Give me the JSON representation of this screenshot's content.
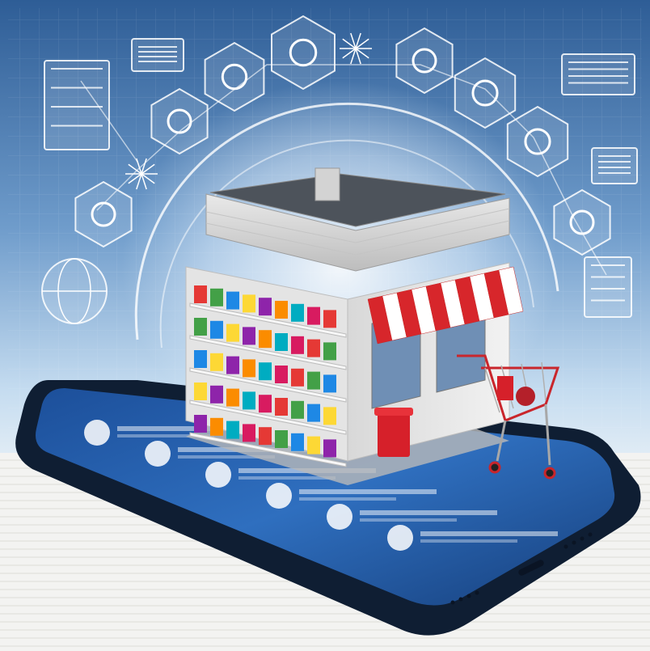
{
  "image": {
    "alt": "",
    "background_color": "#c9dff2",
    "accent_color": "#d7262b",
    "phone_screen_color": "#1e5fae",
    "glow_color": "#e8f4ff"
  },
  "floating_icons": [
    {
      "name": "document-list-icon"
    },
    {
      "name": "browser-window-icon"
    },
    {
      "name": "line-chart-icon"
    },
    {
      "name": "search-icon"
    },
    {
      "name": "network-burst-icon"
    },
    {
      "name": "padlock-icon"
    },
    {
      "name": "shopping-bag-lock-icon"
    },
    {
      "name": "bar-chart-icon"
    },
    {
      "name": "world-map-icon"
    },
    {
      "name": "data-table-icon"
    },
    {
      "name": "home-icon"
    },
    {
      "name": "user-profile-icon"
    },
    {
      "name": "globe-icon"
    },
    {
      "name": "analytics-panel-icon"
    },
    {
      "name": "molecule-network-icon"
    },
    {
      "name": "waveform-panel-icon"
    }
  ],
  "phone_list_rows": 6,
  "store": {
    "awning_colors": [
      "#d7262b",
      "#ffffff"
    ],
    "trash_bin_color": "#d6202a",
    "cart_color": "#c9262c"
  }
}
